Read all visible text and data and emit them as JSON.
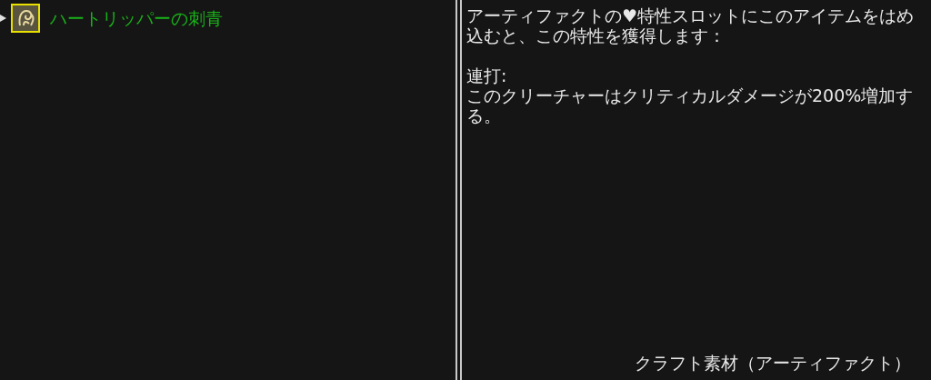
{
  "item_list": [
    {
      "name": "ハートリッパーの刺青",
      "selected": true
    }
  ],
  "details": {
    "description": "アーティファクトの♥特性スロットにこのアイテムをはめ込むと、この特性を獲得します：",
    "trait_name": "連打:",
    "trait_effect": "このクリーチャーはクリティカルダメージが200%増加する。",
    "category": "クラフト素材（アーティファクト）"
  }
}
